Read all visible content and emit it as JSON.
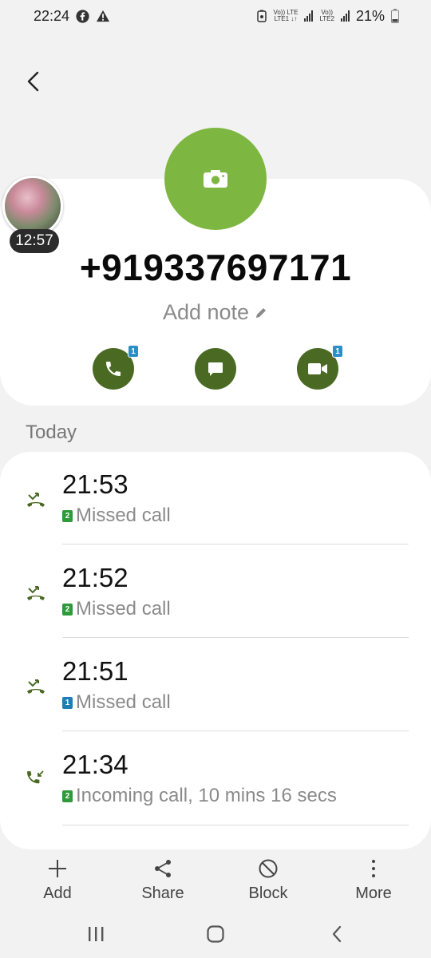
{
  "status_bar": {
    "time": "22:24",
    "battery": "21%",
    "net1": "Vo)) LTE\nLTE1 ↓↑",
    "net2": "Vo))\nLTE2"
  },
  "contact": {
    "number": "+919337697171",
    "add_note": "Add note"
  },
  "bubble": {
    "time": "12:57"
  },
  "actions": {
    "call_badge": "1",
    "video_badge": "1"
  },
  "section": {
    "title": "Today"
  },
  "log": [
    {
      "time": "21:53",
      "sim": "2",
      "desc": "Missed call",
      "type": "missed"
    },
    {
      "time": "21:52",
      "sim": "2",
      "desc": "Missed call",
      "type": "missed"
    },
    {
      "time": "21:51",
      "sim": "1",
      "desc": "Missed call",
      "type": "missed"
    },
    {
      "time": "21:34",
      "sim": "2",
      "desc": "Incoming call, 10 mins 16 secs",
      "type": "incoming"
    }
  ],
  "bottom_bar": {
    "add": "Add",
    "share": "Share",
    "block": "Block",
    "more": "More"
  },
  "colors": {
    "photo_green": "#7db640",
    "action_green": "#4a6a24",
    "sim1": "#1f7fb5",
    "sim2": "#2e9a3a"
  }
}
